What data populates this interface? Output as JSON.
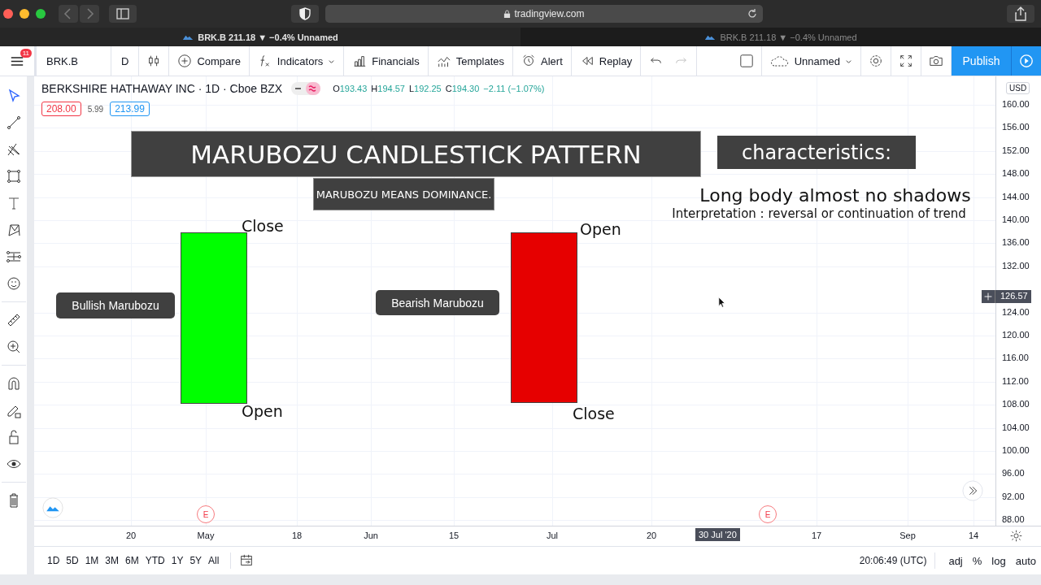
{
  "browser": {
    "url": "tradingview.com"
  },
  "tabs": [
    {
      "title": "BRK.B 211.18 ▼ −0.4% Unnamed",
      "selected": true
    },
    {
      "title": "BRK.B 211.18 ▼ −0.4% Unnamed",
      "selected": false
    }
  ],
  "toolbar": {
    "menu_badge": "11",
    "symbol": "BRK.B",
    "interval": "D",
    "buttons": [
      "Compare",
      "Indicators",
      "Financials",
      "Templates",
      "Alert",
      "Replay"
    ],
    "layout_name": "Unnamed",
    "publish": "Publish"
  },
  "legend": {
    "title": "BERKSHIRE HATHAWAY INC · 1D · Cboe BZX",
    "ohlc": [
      {
        "label": "O",
        "value": "193.43"
      },
      {
        "label": "H",
        "value": "194.57"
      },
      {
        "label": "L",
        "value": "192.25"
      },
      {
        "label": "C",
        "value": "194.30"
      }
    ],
    "change": "−2.11 (−1.07%)",
    "bid": "208.00",
    "spread": "5.99",
    "ask": "213.99"
  },
  "drawings": [
    {
      "kind": "banner",
      "text": "MARUBOZU CANDLESTICK PATTERN"
    },
    {
      "kind": "note",
      "text": "MARUBOZU MEANS DOMINANCE."
    },
    {
      "kind": "banner",
      "text": "characteristics:"
    },
    {
      "kind": "heading",
      "text": "Long body almost no shadows"
    },
    {
      "kind": "text",
      "text": "Interpretation : reversal or continuation of trend"
    },
    {
      "kind": "candle",
      "color": "#00ff00"
    },
    {
      "kind": "label",
      "text": "Close"
    },
    {
      "kind": "label",
      "text": "Open"
    },
    {
      "kind": "callout",
      "text": "Bullish Marubozu"
    },
    {
      "kind": "candle",
      "color": "#e60000"
    },
    {
      "kind": "label",
      "text": "Open"
    },
    {
      "kind": "label",
      "text": "Close"
    },
    {
      "kind": "callout",
      "text": "Bearish Marubozu"
    }
  ],
  "price_axis": {
    "currency": "USD",
    "ticks": [
      "160.00",
      "156.00",
      "152.00",
      "148.00",
      "144.00",
      "140.00",
      "136.00",
      "132.00",
      "124.00",
      "120.00",
      "116.00",
      "112.00",
      "108.00",
      "104.00",
      "100.00",
      "96.00",
      "92.00",
      "88.00"
    ],
    "crosshair_price": "126.57"
  },
  "time_axis": {
    "ticks": [
      "20",
      "May",
      "18",
      "Jun",
      "15",
      "Jul",
      "20",
      "17",
      "Sep",
      "14"
    ],
    "crosshair_date": "30 Jul '20"
  },
  "events": [
    "E",
    "E"
  ],
  "bottom_bar": {
    "ranges": [
      "1D",
      "5D",
      "1M",
      "3M",
      "6M",
      "YTD",
      "1Y",
      "5Y",
      "All"
    ],
    "time": "20:06:49 (UTC)",
    "options": [
      "adj",
      "%",
      "log",
      "auto"
    ]
  }
}
